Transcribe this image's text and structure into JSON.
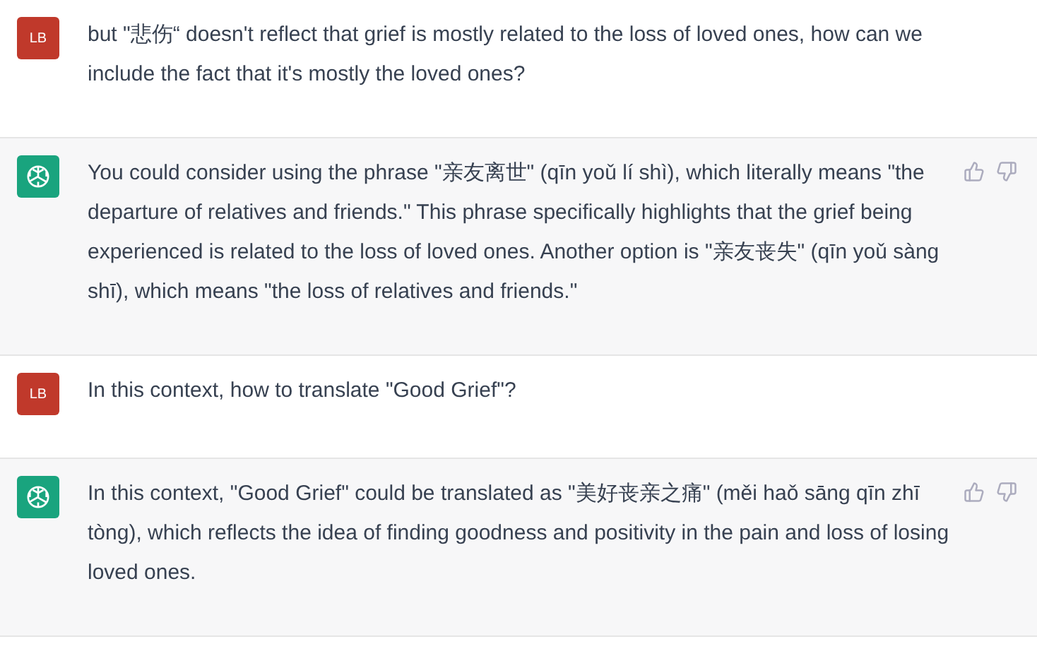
{
  "messages": [
    {
      "kind": "user",
      "avatar": "LB",
      "text": "but \"悲伤“ doesn't reflect that grief is mostly related to the loss of loved ones, how can we include the fact that it's mostly the loved ones?"
    },
    {
      "kind": "assistant",
      "text": "You could consider using the phrase \"亲友离世\" (qīn yoǔ lí shì), which literally means \"the departure of relatives and friends.\" This phrase specifically highlights that the grief being experienced is related to the loss of loved ones. Another option is \"亲友丧失\" (qīn yoǔ sàng shī), which means \"the loss of relatives and friends.\""
    },
    {
      "kind": "user",
      "avatar": "LB",
      "text": "In this context, how to translate \"Good Grief\"?"
    },
    {
      "kind": "assistant",
      "text": "In this context, \"Good Grief\" could be translated as \"美好丧亲之痛\" (měi haǒ sāng qīn zhī tòng), which reflects the idea of finding goodness and positivity in the pain and loss of losing loved ones."
    }
  ]
}
